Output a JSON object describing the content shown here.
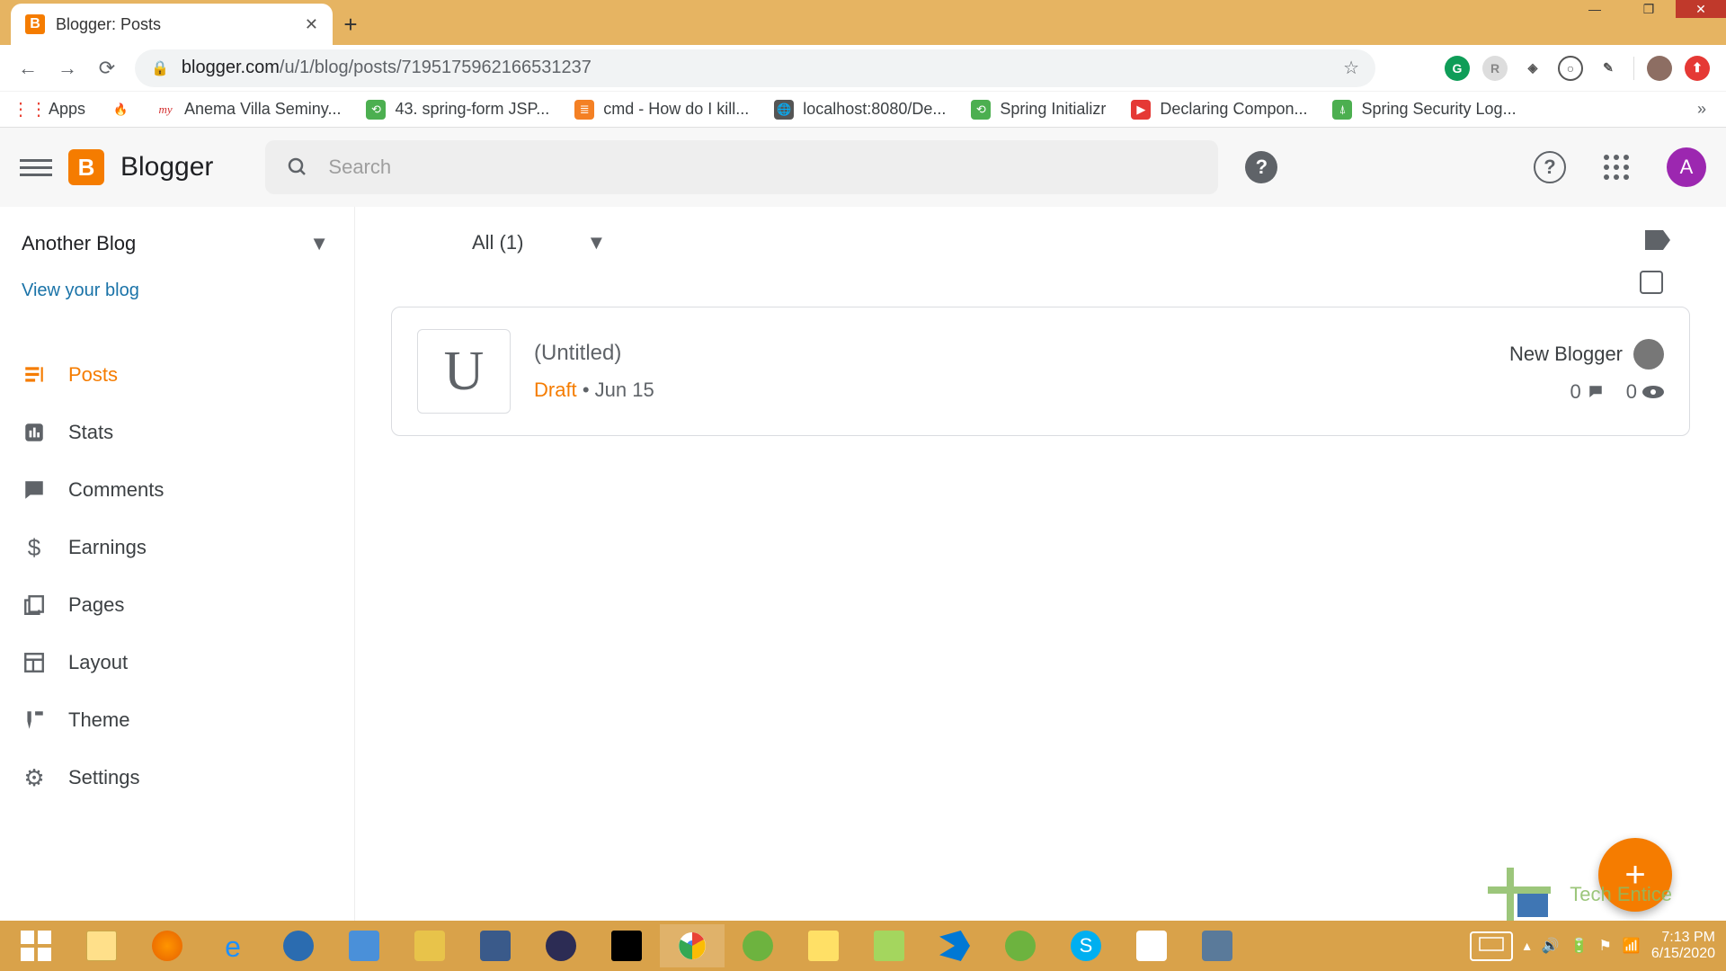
{
  "window": {
    "tab_title": "Blogger: Posts",
    "url_host": "blogger.com",
    "url_path": "/u/1/blog/posts/7195175962166531237"
  },
  "bookmarks": [
    {
      "label": "Apps",
      "color": "#ea4335"
    },
    {
      "label": "",
      "color": "#c0392b"
    },
    {
      "label": "Anema Villa Seminy...",
      "color": "#d32f2f"
    },
    {
      "label": "43. spring-form JSP...",
      "color": "#4caf50"
    },
    {
      "label": "cmd - How do I kill...",
      "color": "#f48024"
    },
    {
      "label": "localhost:8080/De...",
      "color": "#555"
    },
    {
      "label": "Spring Initializr",
      "color": "#4caf50"
    },
    {
      "label": "Declaring Compon...",
      "color": "#e53935"
    },
    {
      "label": "Spring Security Log...",
      "color": "#4caf50"
    }
  ],
  "header": {
    "brand": "Blogger",
    "search_placeholder": "Search",
    "avatar_letter": "A"
  },
  "sidebar": {
    "blog_name": "Another Blog",
    "view_blog": "View your blog",
    "items": [
      {
        "label": "Posts",
        "active": true
      },
      {
        "label": "Stats"
      },
      {
        "label": "Comments"
      },
      {
        "label": "Earnings"
      },
      {
        "label": "Pages"
      },
      {
        "label": "Layout"
      },
      {
        "label": "Theme"
      },
      {
        "label": "Settings"
      }
    ]
  },
  "main": {
    "filter_label": "All (1)",
    "post": {
      "thumb_letter": "U",
      "title": "(Untitled)",
      "status": "Draft",
      "date": "Jun 15",
      "author": "New Blogger",
      "comments": "0",
      "views": "0"
    }
  },
  "watermark": "Tech Entice",
  "tray": {
    "time": "7:13 PM",
    "date": "6/15/2020"
  }
}
